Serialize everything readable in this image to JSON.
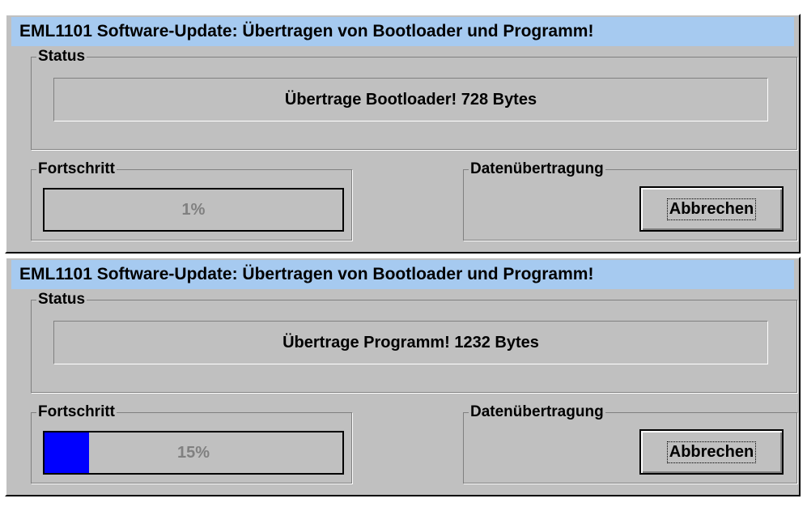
{
  "windows": [
    {
      "title": "EML1101 Software-Update: Übertragen von Bootloader und Programm!",
      "status_group_label": "Status",
      "status_text": "Übertrage Bootloader! 728 Bytes",
      "progress_group_label": "Fortschritt",
      "progress_text": "1%",
      "progress_fraction": 0.01,
      "data_group_label": "Datenübertragung",
      "cancel_label": "Abbrechen"
    },
    {
      "title": "EML1101 Software-Update: Übertragen von Bootloader und Programm!",
      "status_group_label": "Status",
      "status_text": "Übertrage Programm! 1232 Bytes",
      "progress_group_label": "Fortschritt",
      "progress_text": "15%",
      "progress_fraction": 0.15,
      "data_group_label": "Datenübertragung",
      "cancel_label": "Abbrechen"
    }
  ],
  "colors": {
    "titlebar": "#a6caf0",
    "window_bg": "#c0c0c0",
    "progress_fill": "#0000ff",
    "progress_text": "#808080"
  }
}
